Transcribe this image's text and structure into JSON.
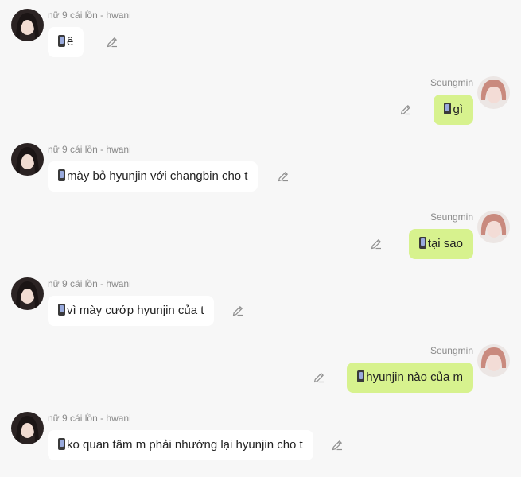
{
  "messages": [
    {
      "side": "left",
      "sender": "nữ 9 cái lồn - hwani",
      "text": "ê",
      "edit_icon": "pencil-icon"
    },
    {
      "side": "right",
      "sender": "Seungmin",
      "text": "gì",
      "edit_icon": "pencil-icon"
    },
    {
      "side": "left",
      "sender": "nữ 9 cái lồn - hwani",
      "text": "mày bỏ hyunjin với changbin cho t",
      "edit_icon": "pencil-icon"
    },
    {
      "side": "right",
      "sender": "Seungmin",
      "text": "tại sao",
      "edit_icon": "pencil-icon"
    },
    {
      "side": "left",
      "sender": "nữ 9 cái lồn - hwani",
      "text": "vì mày cướp hyunjin của t",
      "edit_icon": "pencil-icon"
    },
    {
      "side": "right",
      "sender": "Seungmin",
      "text": "hyunjin nào của m",
      "edit_icon": "pencil-icon"
    },
    {
      "side": "left",
      "sender": "nữ 9 cái lồn - hwani",
      "text": "ko quan tâm m phải nhường lại hyunjin cho t",
      "edit_icon": "pencil-icon"
    }
  ],
  "colors": {
    "background": "#f7f7f7",
    "incoming_bubble": "#ffffff",
    "outgoing_bubble": "#d7f28e",
    "sender_text": "#8a8a8a"
  }
}
